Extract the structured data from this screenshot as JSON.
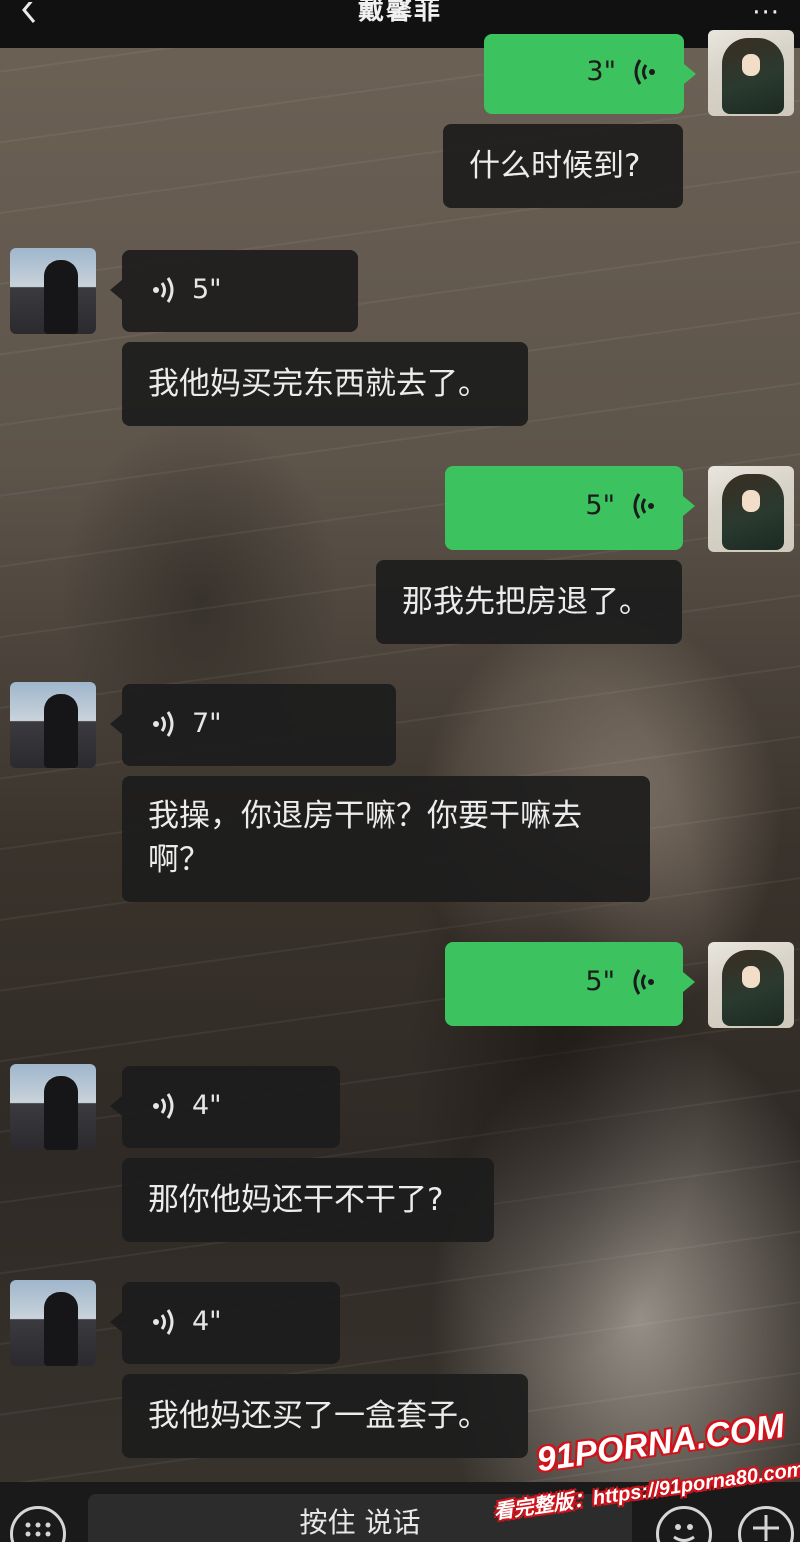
{
  "header": {
    "title": "戴馨菲",
    "more": "···"
  },
  "messages": [
    {
      "from": "self",
      "type": "voice",
      "duration": "3\""
    },
    {
      "from": "self",
      "type": "text",
      "text": "什么时候到?"
    },
    {
      "from": "other",
      "type": "voice",
      "duration": "5\""
    },
    {
      "from": "other",
      "type": "text",
      "text": "我他妈买完东西就去了。"
    },
    {
      "from": "self",
      "type": "voice",
      "duration": "5\""
    },
    {
      "from": "self",
      "type": "text",
      "text": "那我先把房退了。"
    },
    {
      "from": "other",
      "type": "voice",
      "duration": "7\""
    },
    {
      "from": "other",
      "type": "text",
      "text": "我操，你退房干嘛？你要干嘛去啊？"
    },
    {
      "from": "self",
      "type": "voice",
      "duration": "5\""
    },
    {
      "from": "other",
      "type": "voice",
      "duration": "4\""
    },
    {
      "from": "other",
      "type": "text",
      "text": "那你他妈还干不干了?"
    },
    {
      "from": "other",
      "type": "voice",
      "duration": "4\""
    },
    {
      "from": "other",
      "type": "text",
      "text": "我他妈还买了一盒套子。"
    }
  ],
  "input_bar": {
    "talk_label": "按住 说话"
  },
  "watermark": {
    "line1": "91PORNA.COM",
    "line2": "看完整版：https://91porna80.com"
  },
  "colors": {
    "self_bubble": "#3cc25f",
    "other_bubble": "#1c1c1c",
    "bar": "#111111"
  },
  "icons": {
    "back": "chevron-left-icon",
    "voice": "voice-wave-icon",
    "keyboard": "keyboard-icon",
    "emoji": "emoji-icon",
    "plus": "plus-icon"
  }
}
